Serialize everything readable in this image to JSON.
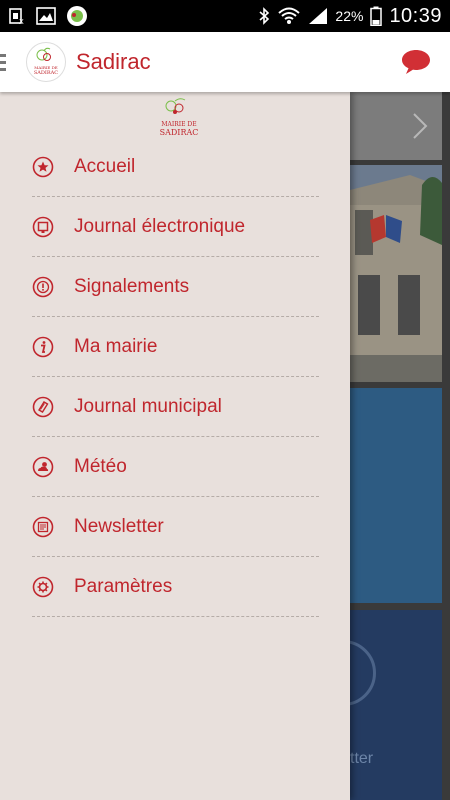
{
  "status_bar": {
    "battery_percent": "22%",
    "time": "10:39",
    "left_icons": [
      "sim-card-icon",
      "gallery-icon",
      "app-notification-icon"
    ],
    "right_icons": [
      "bluetooth-icon",
      "wifi-icon",
      "signal-icon",
      "battery-icon"
    ]
  },
  "app_bar": {
    "title": "Sadirac",
    "logo_lines": [
      "MAIRIE DE",
      "SADIRAC"
    ]
  },
  "drawer": {
    "logo_lines": [
      "MAIRIE DE",
      "SADIRAC"
    ],
    "items": [
      {
        "label": "Accueil",
        "icon": "star-icon"
      },
      {
        "label": "Journal électronique",
        "icon": "tablet-icon"
      },
      {
        "label": "Signalements",
        "icon": "alert-icon"
      },
      {
        "label": "Ma mairie",
        "icon": "info-icon"
      },
      {
        "label": "Journal municipal",
        "icon": "newspaper-icon"
      },
      {
        "label": "Météo",
        "icon": "weather-icon"
      },
      {
        "label": "Newsletter",
        "icon": "newsletter-icon"
      },
      {
        "label": "Paramètres",
        "icon": "gear-icon"
      }
    ]
  },
  "background": {
    "partial_tile_label": "tter"
  },
  "colors": {
    "accent": "#c0262d",
    "drawer_bg": "#e8e0dc",
    "status_bar_bg": "#000000"
  }
}
